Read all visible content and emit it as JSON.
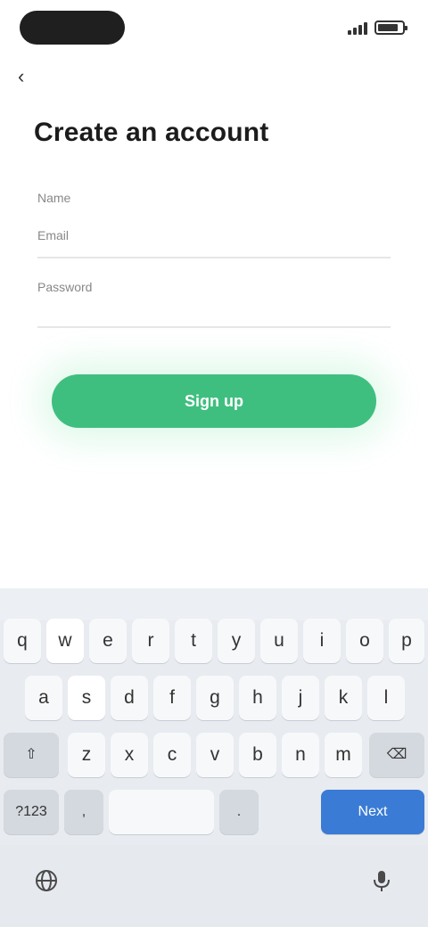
{
  "status_bar": {
    "time": "",
    "signal_icon": "signal-icon",
    "battery_icon": "battery-icon"
  },
  "nav": {
    "back_icon": "back-arrow-icon",
    "back_glyph": "‹"
  },
  "page": {
    "title": "Create an account"
  },
  "form": {
    "name_label": "Name",
    "email_label": "Email",
    "email_value": "",
    "password_label": "Password",
    "password_value": ""
  },
  "actions": {
    "submit_label": "Sign up"
  },
  "keyboard": {
    "row1": [
      "q",
      "w",
      "e",
      "r",
      "t",
      "y",
      "u",
      "i",
      "o",
      "p"
    ],
    "row2": [
      "a",
      "s",
      "d",
      "f",
      "g",
      "h",
      "j",
      "k",
      "l"
    ],
    "row3": [
      "z",
      "x",
      "c",
      "v",
      "b",
      "n",
      "m"
    ],
    "shift_glyph": "⇧",
    "backspace_glyph": "⌫",
    "numbers_label": "?123",
    "comma_label": ",",
    "space_label": "",
    "period_label": ".",
    "enter_label": "Next",
    "emoji_glyph": "☺",
    "globe_icon": "globe-icon",
    "mic_icon": "microphone-icon"
  }
}
